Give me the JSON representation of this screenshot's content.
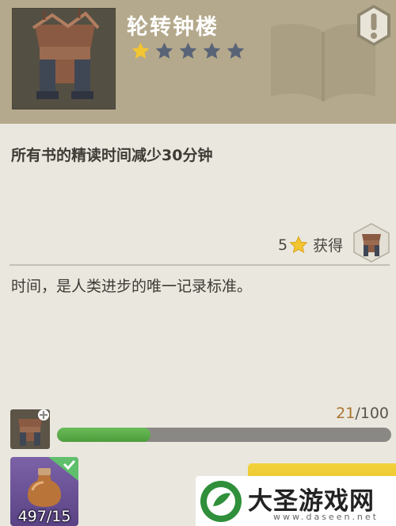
{
  "item": {
    "title": "轮转钟楼",
    "rating": 1,
    "max_rating": 5,
    "icon": "clock-tower-icon"
  },
  "effect_text": "所有书的精读时间减少30分钟",
  "reward": {
    "star_cost": "5",
    "label": "获得",
    "icon": "star-icon"
  },
  "flavor_text": "时间，是人类进步的唯一记录标准。",
  "progress": {
    "current": "21",
    "separator": "/",
    "total": "100",
    "fraction": 0.28
  },
  "resource": {
    "count": "497/15",
    "icon": "potion-bottle-icon",
    "checked": true
  },
  "watermark": {
    "name": "大圣游戏网",
    "url": "www.daseen.net"
  },
  "colors": {
    "header_bg": "#b4a98c",
    "panel_bg": "#eae7df",
    "star_active": "#f3c531",
    "star_inactive": "#5a6478",
    "progress_fill": "#5aad47",
    "progress_track": "#8a8884",
    "confirm_button": "#f2d23b",
    "resource_tile": "#6a52a0"
  }
}
